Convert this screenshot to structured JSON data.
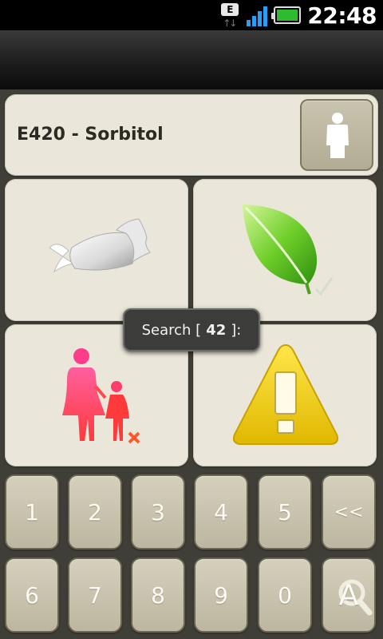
{
  "statusbar": {
    "network_type": "E",
    "time": "22:48"
  },
  "header": {
    "product_name": "E420 - Sorbitol"
  },
  "tiles": [
    {
      "name": "candy",
      "icon": "candy-icon"
    },
    {
      "name": "vegetarian",
      "icon": "green-leaf-check-icon"
    },
    {
      "name": "children",
      "icon": "mother-child-cross-icon"
    },
    {
      "name": "warning",
      "icon": "warning-triangle-icon"
    }
  ],
  "toast": {
    "prefix": "Search [",
    "value": "42",
    "suffix": "]:"
  },
  "keypad": {
    "k1": "1",
    "k2": "2",
    "k3": "3",
    "k4": "4",
    "k5": "5",
    "backspace": "<<",
    "k6": "6",
    "k7": "7",
    "k8": "8",
    "k9": "9",
    "k0": "0",
    "alpha": "A"
  },
  "colors": {
    "panel_bg": "#eae6d9",
    "key_bg": "#c9c4af",
    "app_bg": "#3f3e37",
    "signal_blue": "#2a9df4",
    "battery_green": "#2fbb2f"
  }
}
